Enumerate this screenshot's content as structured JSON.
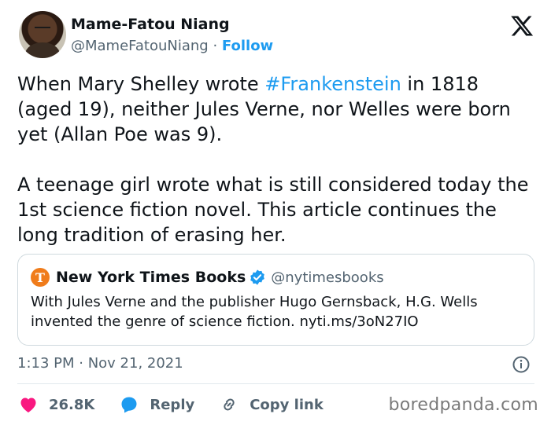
{
  "author": {
    "name": "Mame-Fatou Niang",
    "handle": "@MameFatouNiang",
    "separator": "·",
    "follow_label": "Follow"
  },
  "tweet": {
    "line1_pre": "When Mary Shelley wrote ",
    "hashtag": "#Frankenstein",
    "line1_post": " in 1818 (aged 19), neither Jules Verne, nor Welles were born yet (Allan Poe was 9).",
    "paragraph2": "A teenage girl wrote what is still considered today the 1st science fiction novel. This article continues the long tradition of erasing her."
  },
  "quoted": {
    "logo_letter": "T",
    "name": "New York Times Books",
    "handle": "@nytimesbooks",
    "text": "With Jules Verne and the publisher Hugo Gernsback, H.G. Wells invented the genre of science fiction. nyti.ms/3oN27IO"
  },
  "meta": {
    "timestamp": "1:13 PM · Nov 21, 2021"
  },
  "actions": {
    "likes": "26.8K",
    "reply_label": "Reply",
    "copy_link_label": "Copy link"
  },
  "watermark": "boredpanda.com",
  "colors": {
    "accent": "#1d9bf0",
    "like": "#f91880",
    "text": "#0f1419",
    "muted": "#536471"
  },
  "icons": [
    "x-logo-icon",
    "verified-badge-icon",
    "info-icon",
    "heart-icon",
    "reply-bubble-icon",
    "link-icon"
  ]
}
